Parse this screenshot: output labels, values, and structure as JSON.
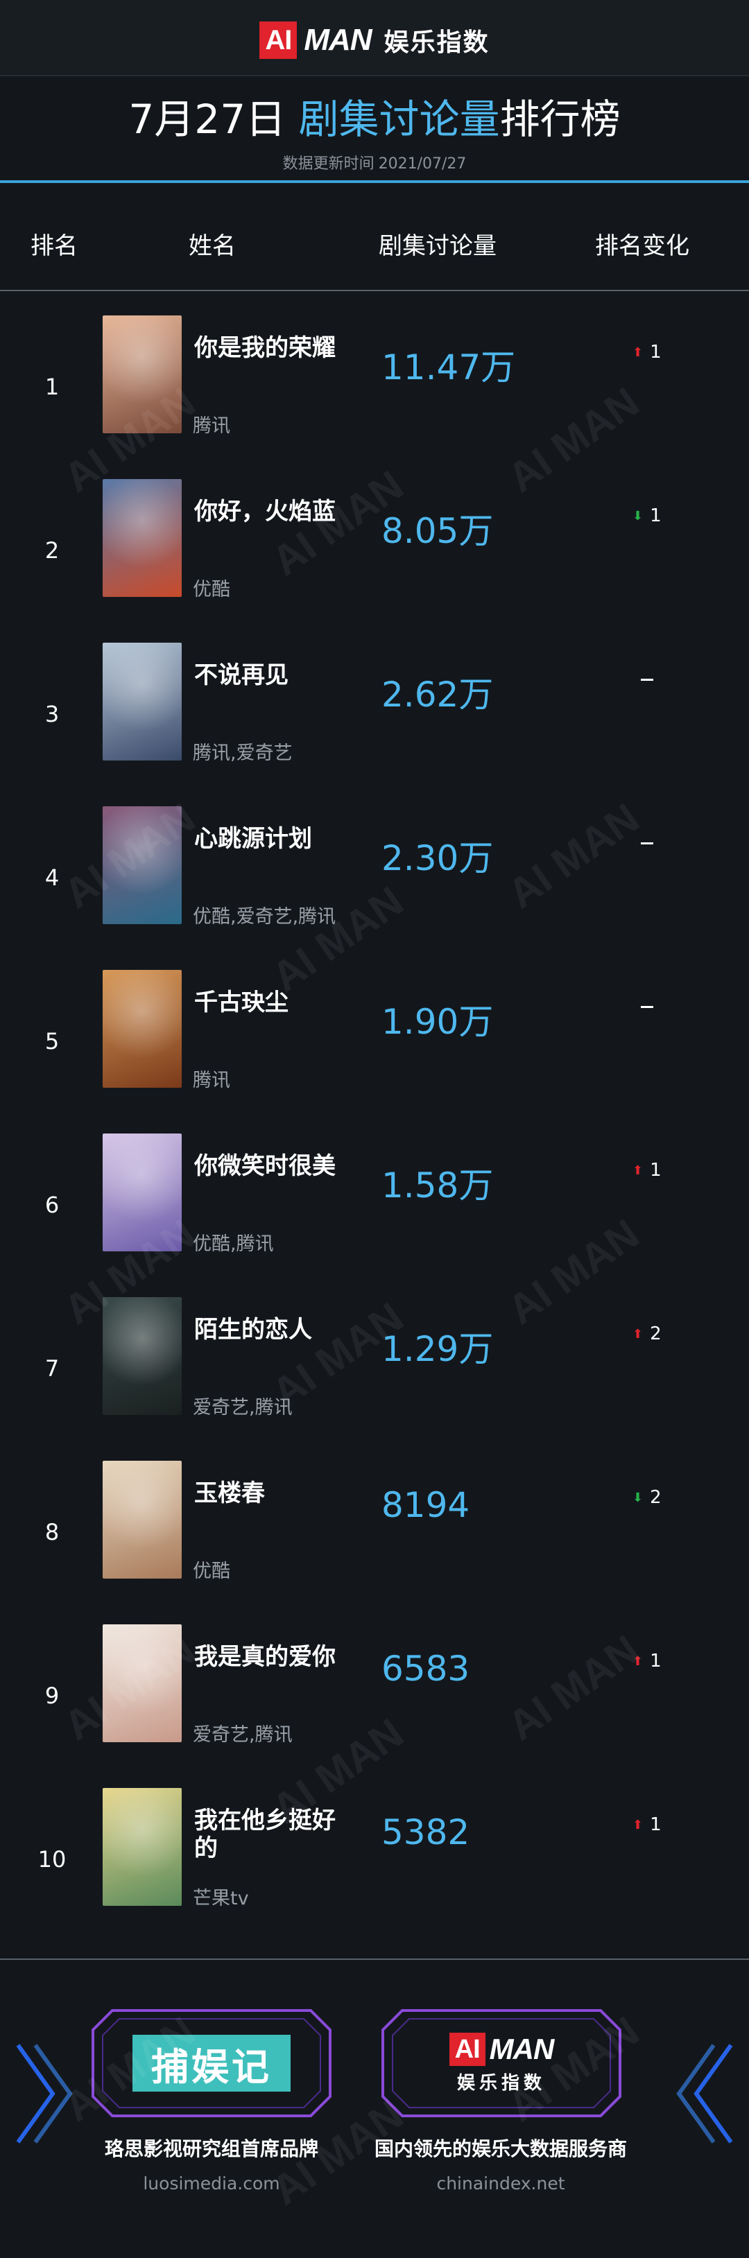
{
  "header": {
    "brand_ai": "AI",
    "brand_man": "MAN",
    "brand_sub": "娱乐指数"
  },
  "title": {
    "date": "7月27日",
    "highlight": "剧集讨论量",
    "suffix": "排行榜"
  },
  "update": {
    "label": "数据更新时间",
    "date": "2021/07/27"
  },
  "columns": [
    "排名",
    "姓名",
    "剧集讨论量",
    "排名变化"
  ],
  "rows": [
    {
      "rank": "1",
      "name": "你是我的荣耀",
      "platform": "腾讯",
      "value": "11.47万",
      "change": "up",
      "change_value": "1",
      "poster_colors": [
        "#e8b89a",
        "#7a4a3a"
      ]
    },
    {
      "rank": "2",
      "name": "你好，火焰蓝",
      "platform": "优酷",
      "value": "8.05万",
      "change": "down",
      "change_value": "1",
      "poster_colors": [
        "#5a7aa8",
        "#c84a2a"
      ]
    },
    {
      "rank": "3",
      "name": "不说再见",
      "platform": "腾讯,爱奇艺",
      "value": "2.62万",
      "change": "same",
      "change_value": "",
      "poster_colors": [
        "#b8c8d8",
        "#3a4a6a"
      ]
    },
    {
      "rank": "4",
      "name": "心跳源计划",
      "platform": "优酷,爱奇艺,腾讯",
      "value": "2.30万",
      "change": "same",
      "change_value": "",
      "poster_colors": [
        "#8a5a7a",
        "#2a6a8a"
      ]
    },
    {
      "rank": "5",
      "name": "千古玦尘",
      "platform": "腾讯",
      "value": "1.90万",
      "change": "same",
      "change_value": "",
      "poster_colors": [
        "#d89a5a",
        "#7a3a1a"
      ]
    },
    {
      "rank": "6",
      "name": "你微笑时很美",
      "platform": "优酷,腾讯",
      "value": "1.58万",
      "change": "up",
      "change_value": "1",
      "poster_colors": [
        "#d8c8e8",
        "#6a5aa8"
      ]
    },
    {
      "rank": "7",
      "name": "陌生的恋人",
      "platform": "爱奇艺,腾讯",
      "value": "1.29万",
      "change": "up",
      "change_value": "2",
      "poster_colors": [
        "#3a4a4a",
        "#1a2020"
      ]
    },
    {
      "rank": "8",
      "name": "玉楼春",
      "platform": "优酷",
      "value": "8194",
      "change": "down",
      "change_value": "2",
      "poster_colors": [
        "#e8d8c0",
        "#a87a5a"
      ]
    },
    {
      "rank": "9",
      "name": "我是真的爱你",
      "platform": "爱奇艺,腾讯",
      "value": "6583",
      "change": "up",
      "change_value": "1",
      "poster_colors": [
        "#f0e8e0",
        "#c89a8a"
      ]
    },
    {
      "rank": "10",
      "name": "我在他乡挺好的",
      "platform": "芒果tv",
      "value": "5382",
      "change": "up",
      "change_value": "1",
      "poster_colors": [
        "#e8d890",
        "#5a8a5a"
      ]
    }
  ],
  "footer": {
    "left_logo": "捕娱记",
    "left_tagline": "珞思影视研究组首席品牌",
    "left_url": "luosimedia.com",
    "right_ai": "AI",
    "right_man": "MAN",
    "right_sub": "娱乐指数",
    "right_tagline": "国内领先的娱乐大数据服务商",
    "right_url": "chinaindex.net"
  },
  "colors": {
    "background": "#13171c",
    "accent_blue": "#4fb8ee",
    "up_red": "#e0232c",
    "down_green": "#26b34a",
    "frame_purple": "#8a4ad8"
  }
}
